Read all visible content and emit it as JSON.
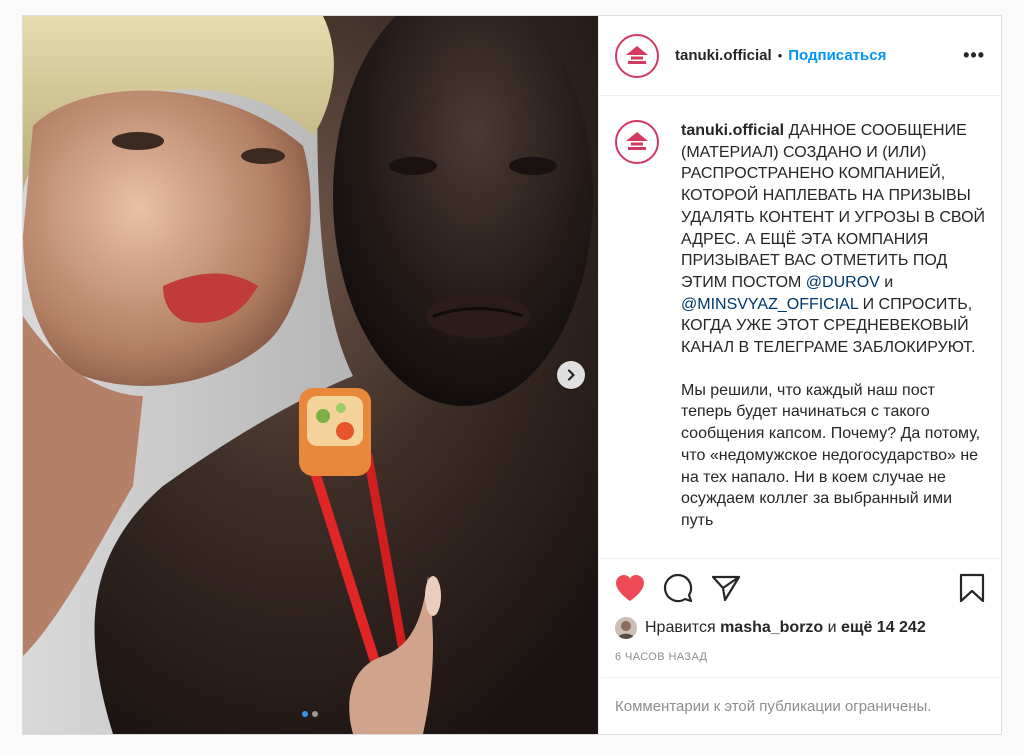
{
  "post": {
    "account": {
      "username": "tanuki.official",
      "separator": "•",
      "follow_label": "Подписаться",
      "more_label": "•••",
      "logo_color": "#d23a60"
    },
    "caption": {
      "username": "tanuki.official",
      "para1_a": "ДАННОЕ СООБЩЕНИЕ (МАТЕРИАЛ) СОЗДАНО И (ИЛИ) РАСПРОСТРАНЕНО КОМПАНИЕЙ, КОТОРОЙ НАПЛЕВАТЬ НА ПРИЗЫВЫ УДАЛЯТЬ КОНТЕНТ И УГРОЗЫ В СВОЙ АДРЕС. А ЕЩЁ ЭТА КОМПАНИЯ ПРИЗЫВАЕТ ВАС ОТМЕТИТЬ ПОД ЭТИМ ПОСТОМ",
      "mention1": "@DUROV",
      "and": "и",
      "mention2": "@MINSVYAZ_OFFICIAL",
      "para1_b": "И СПРОСИТЬ, КОГДА УЖЕ ЭТОТ СРЕДНЕВЕКОВЫЙ КАНАЛ В ТЕЛЕГРАМЕ ЗАБЛОКИРУЮТ.",
      "para2": "Мы решили, что каждый наш пост теперь будет начинаться с такого сообщения капсом. Почему? Да потому, что «недомужское недогосударство» не на тех напало. Ни в коем случае не осуждаем коллег за выбранный ими путь"
    },
    "actions": {
      "like_icon": "heart-filled-icon",
      "comment_icon": "comment-icon",
      "share_icon": "paper-plane-icon",
      "save_icon": "bookmark-icon",
      "heart_color": "#ed4956"
    },
    "likes": {
      "prefix": "Нравится",
      "user": "masha_borzo",
      "and": "и",
      "count": "ещё 14 242"
    },
    "time": "6 ЧАСОВ НАЗАД",
    "comments_note": "Комментарии к этой публикации ограничены.",
    "carousel": {
      "slides": 2,
      "current": 1
    }
  }
}
